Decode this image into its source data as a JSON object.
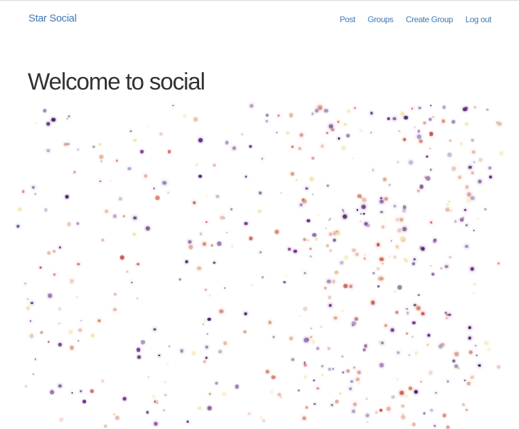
{
  "navbar": {
    "brand": "Star Social",
    "links": [
      {
        "label": "Post"
      },
      {
        "label": "Groups"
      },
      {
        "label": "Create Group"
      },
      {
        "label": "Log out"
      }
    ]
  },
  "main": {
    "title": "Welcome to social"
  },
  "particle_colors": [
    "#4a1a6b",
    "#6b2a8a",
    "#c8594f",
    "#d98b6e",
    "#e7b7a5",
    "#f3e6b0",
    "#9a7fb8"
  ]
}
